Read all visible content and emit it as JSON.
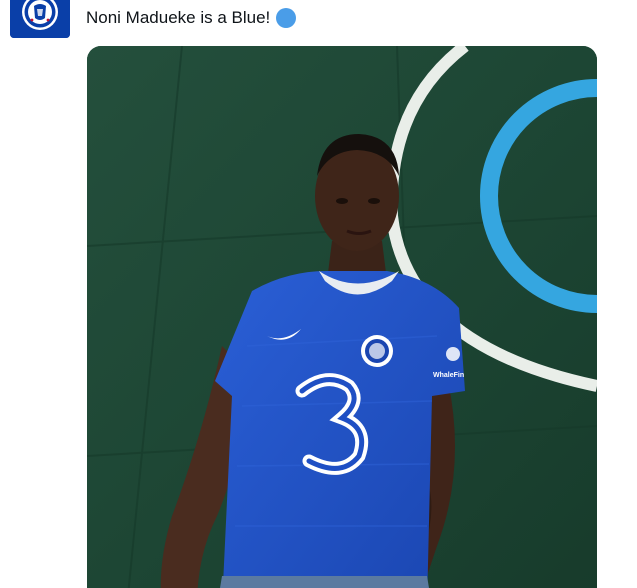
{
  "tweet": {
    "author": {
      "avatar": "chelsea-fc-crest"
    },
    "text": "Noni Madueke is a Blue!",
    "emoji": "blue-circle",
    "media": {
      "type": "photo",
      "sponsor_text": "WhaleFin"
    }
  },
  "colors": {
    "avatar_bg": "#0a3fa8",
    "text": "#0f1419",
    "blue_circle": "#4a9de8",
    "pitch_green": "#1f4a37",
    "kit_blue": "#1f4fc4",
    "line_blue": "#35a6e0"
  }
}
